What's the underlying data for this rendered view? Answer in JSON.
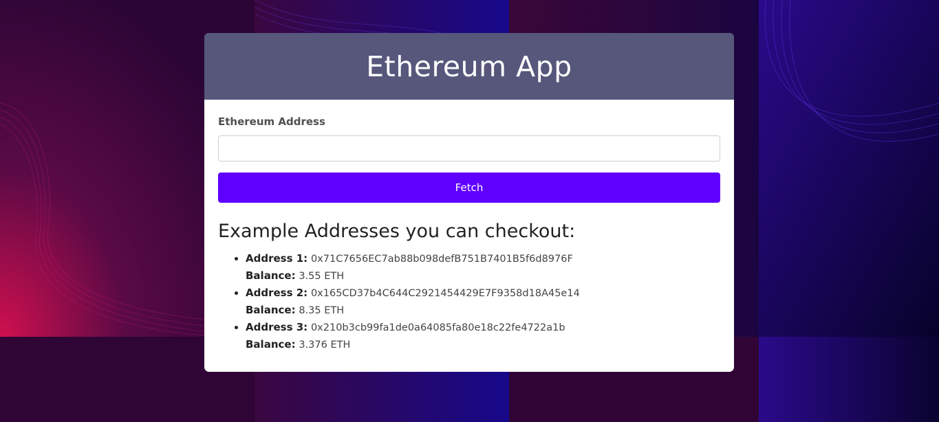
{
  "app": {
    "title": "Ethereum App"
  },
  "form": {
    "address_label": "Ethereum Address",
    "address_value": "",
    "address_placeholder": "",
    "fetch_label": "Fetch"
  },
  "examples": {
    "heading": "Example Addresses you can checkout:",
    "items": [
      {
        "address_key": "Address 1:",
        "address": "0x71C7656EC7ab88b098defB751B7401B5f6d8976F",
        "balance_key": "Balance:",
        "balance": "3.55 ETH"
      },
      {
        "address_key": "Address 2:",
        "address": "0x165CD37b4C644C2921454429E7F9358d18A45e14",
        "balance_key": "Balance:",
        "balance": "8.35 ETH"
      },
      {
        "address_key": "Address 3:",
        "address": "0x210b3cb99fa1de0a64085fa80e18c22fe4722a1b",
        "balance_key": "Balance:",
        "balance": "3.376 ETH"
      }
    ]
  },
  "theme": {
    "header_bg": "#56577b",
    "button_bg": "#6000ff",
    "background_colors": [
      "#3a0840",
      "#c0104a",
      "#1a0a6a",
      "#08022a"
    ]
  }
}
